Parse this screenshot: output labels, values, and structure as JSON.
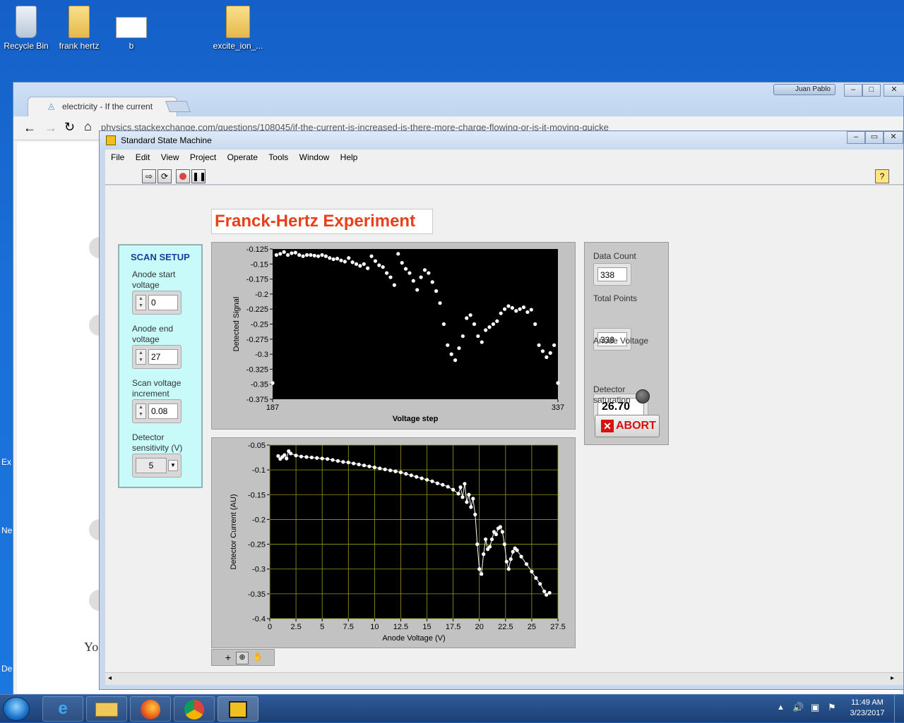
{
  "desktop": {
    "icons": [
      {
        "label": "Recycle Bin",
        "icon": "recycle-bin-icon"
      },
      {
        "label": "frank hertz",
        "icon": "folder-icon"
      },
      {
        "label": "b",
        "icon": "image-thumbnail-icon"
      },
      {
        "label": "excite_ion_...",
        "icon": "folder-icon"
      }
    ],
    "left_edge_labels": [
      "Ex",
      "Ne",
      "De"
    ]
  },
  "browser": {
    "tab_title": "electricity - If the current",
    "url": "physics.stackexchange.com/questions/108045/if-the-current-is-increased-is-there-more-charge-flowing-or-is-it-moving-quicke",
    "profile_name": "Juan Pablo",
    "partial_text": "Yo"
  },
  "labview": {
    "window_title": "Standard State Machine",
    "menu": [
      "File",
      "Edit",
      "View",
      "Project",
      "Operate",
      "Tools",
      "Window",
      "Help"
    ],
    "panel_title": "Franck-Hertz Experiment",
    "scan_setup": {
      "heading": "SCAN SETUP",
      "anode_start_label": "Anode start voltage",
      "anode_start_value": "0",
      "anode_end_label": "Anode end voltage",
      "anode_end_value": "27",
      "scan_increment_label": "Scan voltage increment",
      "scan_increment_value": "0.08",
      "sensitivity_label": "Detector sensitivity (V)",
      "sensitivity_value": "5"
    },
    "indicators": {
      "data_count_label": "Data Count",
      "data_count_value": "338",
      "total_points_label": "Total Points",
      "total_points_value": "338",
      "anode_voltage_label": "Anode Voltage",
      "anode_voltage_value": "26.70",
      "detector_saturation_label": "Detector saturation",
      "abort_label": "ABORT"
    }
  },
  "chart_data": [
    {
      "type": "scatter",
      "xlabel": "Voltage step",
      "ylabel": "Detected Signal",
      "xlim": [
        187,
        337
      ],
      "ylim": [
        -0.375,
        -0.125
      ],
      "x_tick_labels": [
        "187",
        "337"
      ],
      "y_tick_labels": [
        "-0.125",
        "-0.15",
        "-0.175",
        "-0.2",
        "-0.225",
        "-0.25",
        "-0.275",
        "-0.3",
        "-0.325",
        "-0.35",
        "-0.375"
      ],
      "grid": false,
      "series": [
        {
          "points": [
            [
              187,
              -0.348
            ],
            [
              189,
              -0.135
            ],
            [
              191,
              -0.133
            ],
            [
              193,
              -0.13
            ],
            [
              195,
              -0.135
            ],
            [
              197,
              -0.132
            ],
            [
              199,
              -0.131
            ],
            [
              201,
              -0.135
            ],
            [
              203,
              -0.137
            ],
            [
              205,
              -0.135
            ],
            [
              207,
              -0.135
            ],
            [
              209,
              -0.136
            ],
            [
              211,
              -0.137
            ],
            [
              213,
              -0.135
            ],
            [
              215,
              -0.137
            ],
            [
              217,
              -0.14
            ],
            [
              219,
              -0.142
            ],
            [
              221,
              -0.141
            ],
            [
              223,
              -0.144
            ],
            [
              225,
              -0.146
            ],
            [
              227,
              -0.14
            ],
            [
              229,
              -0.147
            ],
            [
              231,
              -0.15
            ],
            [
              233,
              -0.153
            ],
            [
              235,
              -0.15
            ],
            [
              237,
              -0.157
            ],
            [
              239,
              -0.137
            ],
            [
              241,
              -0.145
            ],
            [
              243,
              -0.152
            ],
            [
              245,
              -0.155
            ],
            [
              247,
              -0.165
            ],
            [
              249,
              -0.172
            ],
            [
              251,
              -0.185
            ],
            [
              253,
              -0.133
            ],
            [
              255,
              -0.148
            ],
            [
              257,
              -0.158
            ],
            [
              259,
              -0.165
            ],
            [
              261,
              -0.178
            ],
            [
              263,
              -0.193
            ],
            [
              265,
              -0.172
            ],
            [
              267,
              -0.16
            ],
            [
              269,
              -0.165
            ],
            [
              271,
              -0.18
            ],
            [
              273,
              -0.195
            ],
            [
              275,
              -0.215
            ],
            [
              277,
              -0.25
            ],
            [
              279,
              -0.285
            ],
            [
              281,
              -0.3
            ],
            [
              283,
              -0.31
            ],
            [
              285,
              -0.29
            ],
            [
              287,
              -0.27
            ],
            [
              289,
              -0.24
            ],
            [
              291,
              -0.235
            ],
            [
              293,
              -0.25
            ],
            [
              295,
              -0.27
            ],
            [
              297,
              -0.28
            ],
            [
              299,
              -0.26
            ],
            [
              301,
              -0.255
            ],
            [
              303,
              -0.25
            ],
            [
              305,
              -0.245
            ],
            [
              307,
              -0.232
            ],
            [
              309,
              -0.225
            ],
            [
              311,
              -0.22
            ],
            [
              313,
              -0.223
            ],
            [
              315,
              -0.228
            ],
            [
              317,
              -0.225
            ],
            [
              319,
              -0.222
            ],
            [
              321,
              -0.23
            ],
            [
              323,
              -0.226
            ],
            [
              325,
              -0.25
            ],
            [
              327,
              -0.285
            ],
            [
              329,
              -0.295
            ],
            [
              331,
              -0.305
            ],
            [
              333,
              -0.298
            ],
            [
              335,
              -0.285
            ],
            [
              337,
              -0.348
            ]
          ]
        }
      ]
    },
    {
      "type": "scatter",
      "xlabel": "Anode Voltage (V)",
      "ylabel": "Detector Current (AU)",
      "xlim": [
        0,
        27.5
      ],
      "ylim": [
        -0.4,
        -0.05
      ],
      "x_tick_labels": [
        "0",
        "2.5",
        "5",
        "7.5",
        "10",
        "12.5",
        "15",
        "17.5",
        "20",
        "22.5",
        "25",
        "27.5"
      ],
      "y_tick_labels": [
        "-0.05",
        "-0.1",
        "-0.15",
        "-0.2",
        "-0.25",
        "-0.3",
        "-0.35",
        "-0.4"
      ],
      "grid": true,
      "series": [
        {
          "points": [
            [
              0.8,
              -0.072
            ],
            [
              1.0,
              -0.078
            ],
            [
              1.2,
              -0.074
            ],
            [
              1.4,
              -0.07
            ],
            [
              1.6,
              -0.077
            ],
            [
              1.8,
              -0.062
            ],
            [
              2.0,
              -0.067
            ],
            [
              2.5,
              -0.071
            ],
            [
              3.0,
              -0.073
            ],
            [
              3.5,
              -0.074
            ],
            [
              4.0,
              -0.075
            ],
            [
              4.5,
              -0.076
            ],
            [
              5.0,
              -0.077
            ],
            [
              5.5,
              -0.078
            ],
            [
              6.0,
              -0.08
            ],
            [
              6.5,
              -0.082
            ],
            [
              7.0,
              -0.084
            ],
            [
              7.5,
              -0.085
            ],
            [
              8.0,
              -0.087
            ],
            [
              8.5,
              -0.089
            ],
            [
              9.0,
              -0.091
            ],
            [
              9.5,
              -0.093
            ],
            [
              10.0,
              -0.095
            ],
            [
              10.5,
              -0.097
            ],
            [
              11.0,
              -0.099
            ],
            [
              11.5,
              -0.101
            ],
            [
              12.0,
              -0.103
            ],
            [
              12.5,
              -0.105
            ],
            [
              13.0,
              -0.108
            ],
            [
              13.5,
              -0.111
            ],
            [
              14.0,
              -0.114
            ],
            [
              14.5,
              -0.117
            ],
            [
              15.0,
              -0.12
            ],
            [
              15.5,
              -0.123
            ],
            [
              16.0,
              -0.127
            ],
            [
              16.5,
              -0.13
            ],
            [
              17.0,
              -0.134
            ],
            [
              17.5,
              -0.14
            ],
            [
              18.0,
              -0.148
            ],
            [
              18.2,
              -0.135
            ],
            [
              18.4,
              -0.155
            ],
            [
              18.6,
              -0.128
            ],
            [
              18.8,
              -0.165
            ],
            [
              19.0,
              -0.15
            ],
            [
              19.2,
              -0.175
            ],
            [
              19.4,
              -0.158
            ],
            [
              19.6,
              -0.19
            ],
            [
              19.8,
              -0.25
            ],
            [
              20.0,
              -0.3
            ],
            [
              20.2,
              -0.31
            ],
            [
              20.4,
              -0.27
            ],
            [
              20.6,
              -0.24
            ],
            [
              20.8,
              -0.26
            ],
            [
              21.0,
              -0.255
            ],
            [
              21.2,
              -0.24
            ],
            [
              21.4,
              -0.225
            ],
            [
              21.6,
              -0.23
            ],
            [
              21.8,
              -0.218
            ],
            [
              22.0,
              -0.215
            ],
            [
              22.2,
              -0.225
            ],
            [
              22.4,
              -0.25
            ],
            [
              22.6,
              -0.285
            ],
            [
              22.8,
              -0.3
            ],
            [
              23.0,
              -0.28
            ],
            [
              23.2,
              -0.265
            ],
            [
              23.4,
              -0.258
            ],
            [
              23.6,
              -0.262
            ],
            [
              24.0,
              -0.275
            ],
            [
              24.5,
              -0.29
            ],
            [
              25.0,
              -0.305
            ],
            [
              25.4,
              -0.318
            ],
            [
              25.8,
              -0.33
            ],
            [
              26.2,
              -0.345
            ],
            [
              26.4,
              -0.352
            ],
            [
              26.7,
              -0.348
            ]
          ]
        }
      ]
    }
  ],
  "taskbar": {
    "apps": [
      "internet-explorer-icon",
      "file-explorer-icon",
      "firefox-icon",
      "chrome-icon",
      "labview-icon"
    ],
    "time": "11:49 AM",
    "date": "3/23/2017"
  }
}
